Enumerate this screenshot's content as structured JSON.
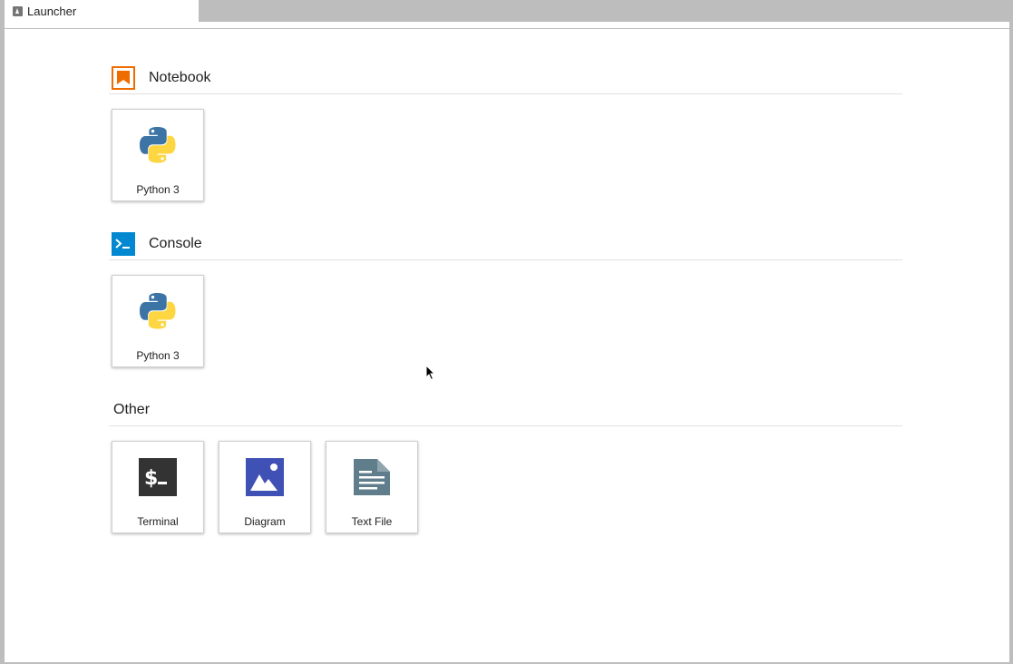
{
  "tab": {
    "label": "Launcher",
    "icon": "launcher-icon"
  },
  "sections": [
    {
      "title": "Notebook",
      "icon": "notebook-icon",
      "icon_color": "#ef6c00",
      "items": [
        {
          "label": "Python 3",
          "icon": "python-icon"
        }
      ]
    },
    {
      "title": "Console",
      "icon": "console-icon",
      "icon_color": "#0288d1",
      "items": [
        {
          "label": "Python 3",
          "icon": "python-icon"
        }
      ]
    },
    {
      "title": "Other",
      "icon": "",
      "items": [
        {
          "label": "Terminal",
          "icon": "terminal-icon",
          "icon_color": "#333333"
        },
        {
          "label": "Diagram",
          "icon": "diagram-icon",
          "icon_color": "#3f51b5"
        },
        {
          "label": "Text File",
          "icon": "text-file-icon",
          "icon_color": "#607d8b"
        }
      ]
    }
  ]
}
